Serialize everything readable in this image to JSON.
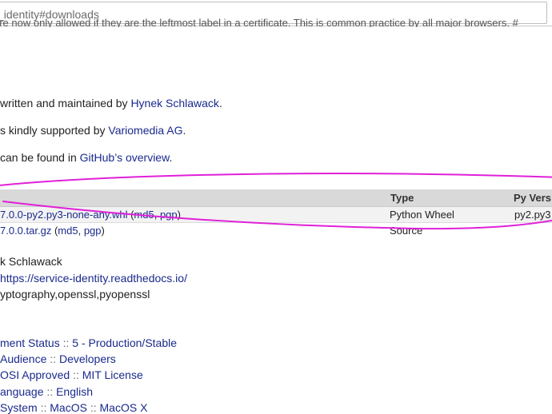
{
  "browser": {
    "url": "_identity#downloads"
  },
  "page": {
    "cut_text": "are now only allowed if they are the leftmost label in a certificate. This is common practice by all major browsers. #",
    "author_line": {
      "prefix": "written and maintained by ",
      "link": "Hynek Schlawack",
      "suffix": "."
    },
    "support_line": {
      "prefix": "s kindly supported by ",
      "link": "Variomedia AG",
      "suffix": "."
    },
    "github_line": {
      "prefix": "can be found in ",
      "link": "GitHub’s overview",
      "suffix": "."
    }
  },
  "downloads_table": {
    "headers": {
      "type": "Type",
      "pyversion": "Py Vers"
    },
    "rows": [
      {
        "file": "7.0.0-py2.py3-none-any.whl",
        "md5": "md5",
        "pgp": "pgp",
        "type": "Python Wheel",
        "pyversion": "py2.py3"
      },
      {
        "file": "7.0.0.tar.gz",
        "md5": "md5",
        "pgp": "pgp",
        "type": "Source",
        "pyversion": ""
      }
    ],
    "punct": {
      "open": " (",
      "sep": ", ",
      "close": ")"
    }
  },
  "meta": {
    "author": "k Schlawack",
    "home_page": "https://service-identity.readthedocs.io/",
    "keywords": "yptography,openssl,pyopenssl"
  },
  "classifiers": [
    {
      "a": "ment Status",
      "b": "5 - Production/Stable"
    },
    {
      "a": "Audience",
      "b": "Developers"
    },
    {
      "a": "OSI Approved",
      "b": "MIT License"
    },
    {
      "a": "anguage",
      "b": "English"
    },
    {
      "a": "System",
      "b": "MacOS",
      "c": "MacOS X"
    }
  ],
  "classifier_sep": " :: ",
  "annotation": {
    "color": "#e020d8"
  }
}
